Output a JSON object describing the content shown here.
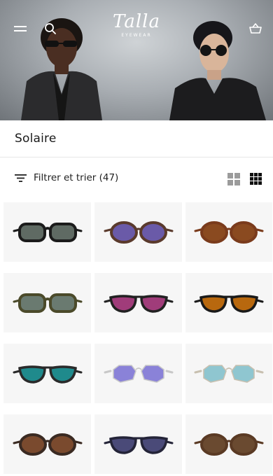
{
  "header": {
    "menu_icon": "hamburger-icon",
    "search_icon": "search-icon",
    "logo_script": "Talla",
    "logo_sub": "EYEWEAR",
    "basket_icon": "basket-icon"
  },
  "page": {
    "title": "Solaire"
  },
  "filter": {
    "icon": "filter-icon",
    "label": "Filtrer et trier (47)"
  },
  "view_toggle": {
    "two_column_icon": "grid-2-icon",
    "three_column_icon": "grid-3-icon",
    "active": "three_column"
  },
  "products": [
    {
      "frame": "#1b1b1b",
      "lens": "#5f6a63",
      "shape": "rect"
    },
    {
      "frame": "#5a3a2c",
      "lens": "#6a5aa8",
      "shape": "round"
    },
    {
      "frame": "#7a3b1c",
      "lens": "#8a4a20",
      "shape": "round"
    },
    {
      "frame": "#4b4a2a",
      "lens": "#6a7a70",
      "shape": "rect"
    },
    {
      "frame": "#222222",
      "lens": "#a03c7a",
      "shape": "aviator"
    },
    {
      "frame": "#1a1a1a",
      "lens": "#b8680e",
      "shape": "aviator"
    },
    {
      "frame": "#2a2a2a",
      "lens": "#1f8a8c",
      "shape": "aviator"
    },
    {
      "frame": "#c8c8c8",
      "lens": "#8a82d8",
      "shape": "hex"
    },
    {
      "frame": "#c8c0b0",
      "lens": "#8fc6d0",
      "shape": "hex"
    },
    {
      "frame": "#3a2a22",
      "lens": "#7a4a2e",
      "shape": "round"
    },
    {
      "frame": "#242438",
      "lens": "#4a4a78",
      "shape": "aviator"
    },
    {
      "frame": "#5a3a24",
      "lens": "#6a4a30",
      "shape": "round"
    }
  ]
}
